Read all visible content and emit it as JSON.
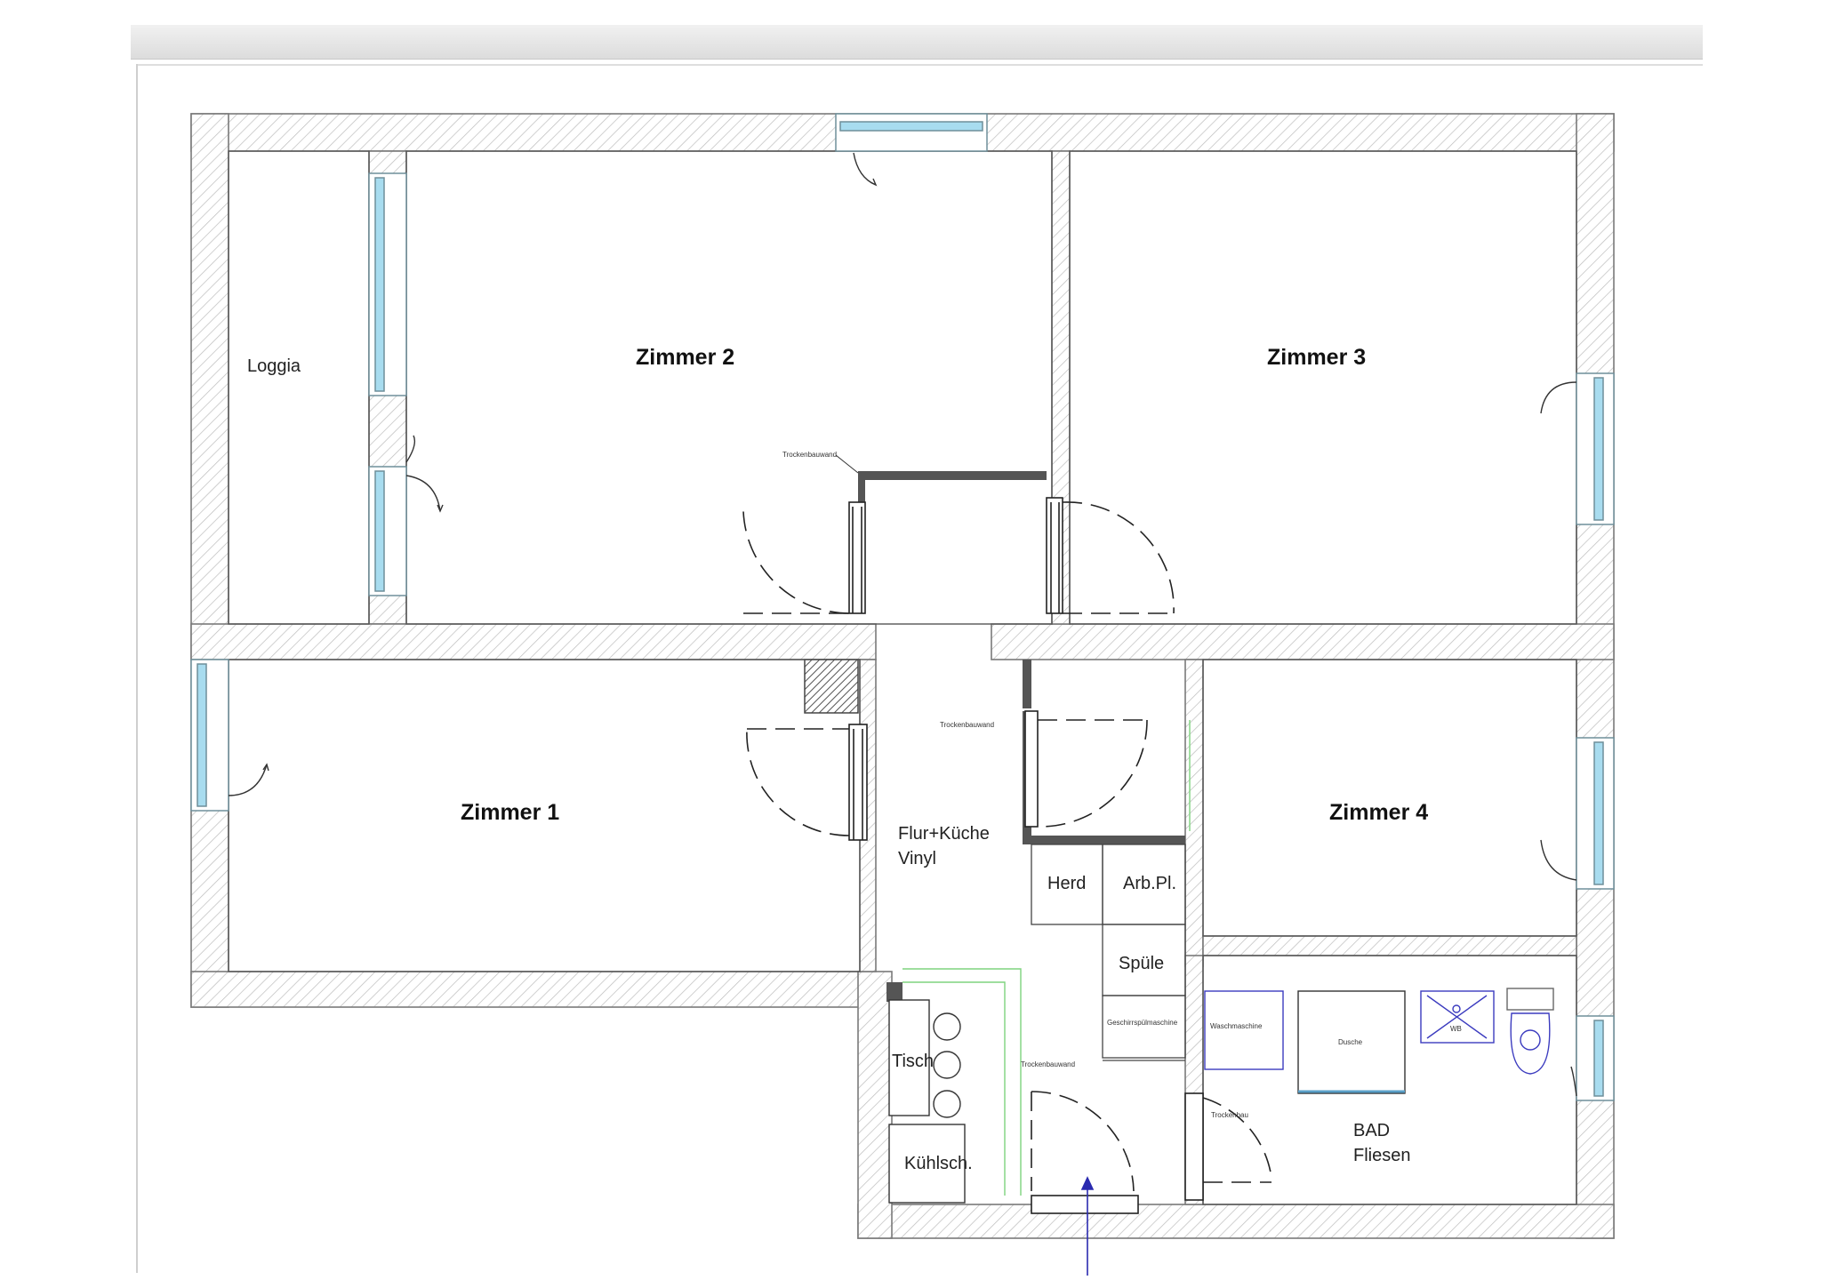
{
  "rooms": {
    "loggia": "Loggia",
    "zimmer1": "Zimmer 1",
    "zimmer2": "Zimmer 2",
    "zimmer3": "Zimmer 3",
    "zimmer4": "Zimmer 4",
    "flur_line1": "Flur+Küche",
    "flur_line2": "Vinyl",
    "bad_line1": "BAD",
    "bad_line2": "Fliesen"
  },
  "fixtures": {
    "herd": "Herd",
    "arbeitsplatte": "Arb.Pl.",
    "spuele": "Spüle",
    "tisch": "Tisch",
    "kuehlschrank": "Kühlsch.",
    "geschirrspuelmaschine": "Geschirrspülmaschine",
    "waschmaschine": "Waschmaschine",
    "dusche": "Dusche",
    "wb": "WB"
  },
  "annotations": {
    "trockenbauwand_top": "Trockenbauwand",
    "trockenbauwand_mid": "Trockenbauwand",
    "trockenbauwand_low": "Trockenbauwand",
    "trockenbau_bad": "Trockenbau"
  },
  "colors": {
    "wall": "#8a8a8a",
    "hatch": "#bdbdbd",
    "window_glass": "#a8dcef",
    "drywall": "#555555",
    "green_line": "#7ed37e",
    "fixture_blue": "#3b3bbf",
    "entry_arrow": "#2b2bb0"
  }
}
